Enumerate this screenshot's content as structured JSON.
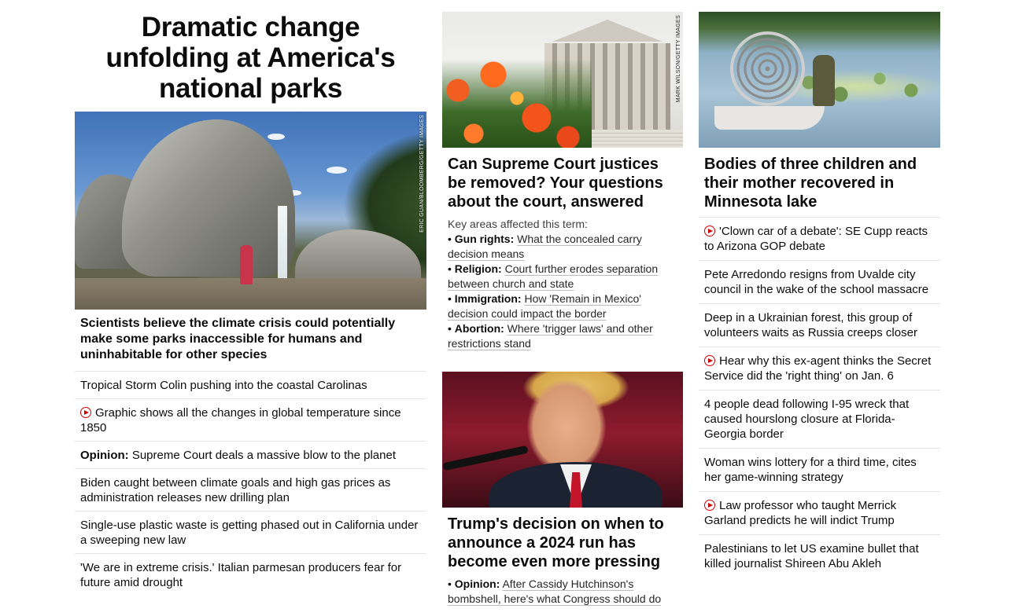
{
  "lead": {
    "title": "Dramatic change unfolding at America's national parks",
    "image_credit": "ERIC GUAN/BLOOMBERG/GETTY IMAGES",
    "subheadline": "Scientists believe the climate crisis could potentially make some parks inaccessible for humans and uninhabitable for other species",
    "items": [
      {
        "prefix": "",
        "text": "Tropical Storm Colin pushing into the coastal Carolinas",
        "video": false
      },
      {
        "prefix": "",
        "text": "Graphic shows all the changes in global temperature since 1850",
        "video": true
      },
      {
        "prefix": "Opinion:",
        "text": " Supreme Court deals a massive blow to the planet",
        "video": false
      },
      {
        "prefix": "",
        "text": "Biden caught between climate goals and high gas prices as administration releases new drilling plan",
        "video": false
      },
      {
        "prefix": "",
        "text": "Single-use plastic waste is getting phased out in California under a sweeping new law",
        "video": false
      },
      {
        "prefix": "",
        "text": "'We are in extreme crisis.' Italian parmesan producers fear for future amid drought",
        "video": false
      }
    ]
  },
  "court_story": {
    "image_credit": "MARK WILSON/GETTY IMAGES",
    "headline": "Can Supreme Court justices be removed? Your questions about the court, answered",
    "intro": "Key areas affected this term:",
    "bullets": [
      {
        "label": "Gun rights:",
        "text": "What the concealed carry decision means"
      },
      {
        "label": "Religion:",
        "text": "Court further erodes separation between church and state"
      },
      {
        "label": "Immigration:",
        "text": "How 'Remain in Mexico' decision could impact the border"
      },
      {
        "label": "Abortion:",
        "text": "Where 'trigger laws' and other restrictions stand"
      }
    ]
  },
  "trump_story": {
    "headline": "Trump's decision on when to announce a 2024 run has become even more pressing",
    "bullets": [
      {
        "label": "Opinion:",
        "text": "After Cassidy Hutchinson's bombshell, here's what Congress should do"
      }
    ]
  },
  "lake_story": {
    "headline": "Bodies of three children and their mother recovered in Minnesota lake",
    "items": [
      {
        "text": "'Clown car of a debate': SE Cupp reacts to Arizona GOP debate",
        "video": true
      },
      {
        "text": "Pete Arredondo resigns from Uvalde city council in the wake of the school massacre",
        "video": false
      },
      {
        "text": "Deep in a Ukrainian forest, this group of volunteers waits as Russia creeps closer",
        "video": false
      },
      {
        "text": "Hear why this ex-agent thinks the Secret Service did the 'right thing' on Jan. 6",
        "video": true
      },
      {
        "text": "4 people dead following I-95 wreck that caused hourslong closure at Florida-Georgia border",
        "video": false
      },
      {
        "text": "Woman wins lottery for a third time, cites her game-winning strategy",
        "video": false
      },
      {
        "text": "Law professor who taught Merrick Garland predicts he will indict Trump",
        "video": true
      },
      {
        "text": "Palestinians to let US examine bullet that killed journalist Shireen Abu Akleh",
        "video": false
      }
    ]
  },
  "colors": {
    "video_icon": "#cc0000",
    "divider": "#e6e6e6"
  }
}
